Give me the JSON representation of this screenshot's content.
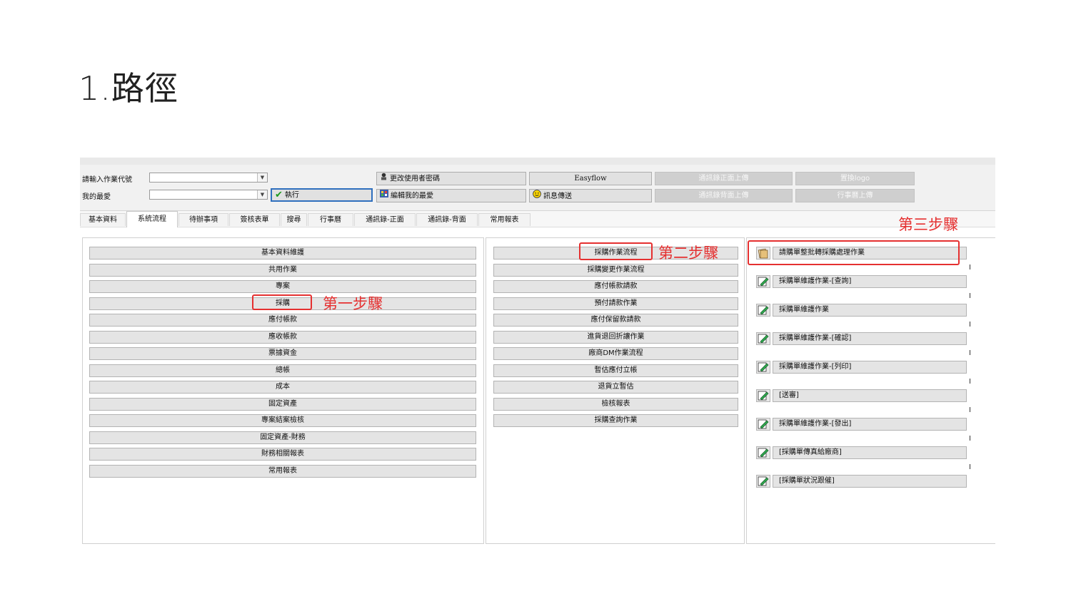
{
  "slide": {
    "title": "1.路徑"
  },
  "toolbar": {
    "input_code_label": "請輸入作業代號",
    "favorites_label": "我的最愛",
    "input_code_value": "",
    "favorites_value": "",
    "execute_button": "執行",
    "change_password_button": "更改使用者密碼",
    "edit_favorites_button": "編輯我的最愛",
    "easyflow_button": "Easyflow",
    "message_button": "訊息傳送",
    "contacts_front_upload": "通訊錄正面上傳",
    "contacts_back_upload": "通訊錄背面上傳",
    "replace_logo": "置換logo",
    "calendar_upload": "行事曆上傳"
  },
  "tabs": [
    "基本資料",
    "系統流程",
    "待辦事項",
    "簽核表單",
    "搜尋",
    "行事曆",
    "通訊錄-正面",
    "通訊錄-背面",
    "常用報表"
  ],
  "active_tab": "系統流程",
  "left_menu": [
    "基本資料維護",
    "共用作業",
    "專案",
    "採購",
    "應付帳款",
    "應收帳款",
    "票據資金",
    "總帳",
    "成本",
    "固定資產",
    "專案結案檢核",
    "固定資產-財務",
    "財務相關報表",
    "常用報表"
  ],
  "middle_menu": [
    "採購作業流程",
    "採購變更作業流程",
    "應付帳款請款",
    "預付請款作業",
    "應付保留款請款",
    "進貨退回折讓作業",
    "廠商DM作業流程",
    "暫估應付立帳",
    "退貨立暫估",
    "檢核報表",
    "採購查詢作業"
  ],
  "right_menu": [
    "請購單整批轉採購處理作業",
    "採購單維護作業-[查詢]",
    "採購單維護作業",
    "採購單維護作業-[確認]",
    "採購單維護作業-[列印]",
    "[送審]",
    "採購單維護作業-[發出]",
    "[採購單傳真給廠商]",
    "[採購單狀況跟催]"
  ],
  "annotations": {
    "step1": "第一步驟",
    "step2": "第二步驟",
    "step3": "第三步驟",
    "color": "#e53030"
  }
}
